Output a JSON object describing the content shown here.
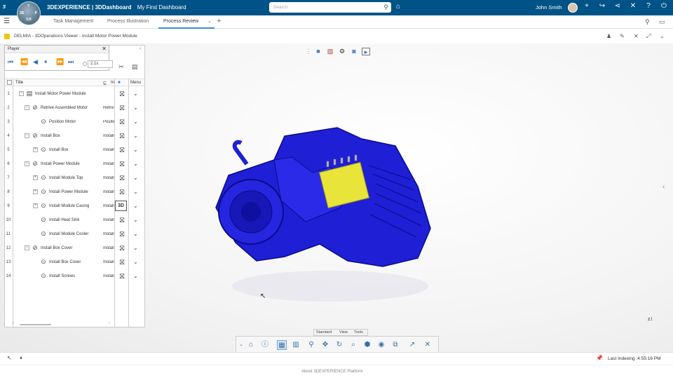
{
  "topbar": {
    "brand_bold": "3DEXPERIENCE | 3DDashboard",
    "dashboard": "My First Dashboard",
    "search_placeholder": "Search",
    "user_name": "John Smith",
    "compass": {
      "top": "?",
      "left": "3D",
      "right": "P",
      "bottom": "V,R"
    }
  },
  "tabs": [
    {
      "label": "Task Management"
    },
    {
      "label": "Process Illustration"
    },
    {
      "label": "Process Review"
    }
  ],
  "app": {
    "title": "DELMIA - 3DOperations Viewer - Install Motor Power Module"
  },
  "player": {
    "title": "Player",
    "time": "2.1s"
  },
  "grid": {
    "col_title": "Title",
    "col_instr": "In",
    "col_menu": "Menu",
    "rows": [
      {
        "num": "1",
        "title": "Install Motor Power Module",
        "instr": "",
        "status": "no-3d",
        "level": 0
      },
      {
        "num": "2",
        "title": "Retrive Assembled Motor",
        "instr": "Retriv",
        "status": "no-3d",
        "level": 1
      },
      {
        "num": "3",
        "title": "Position Motor",
        "instr": "Positio",
        "status": "no-3d",
        "level": 2
      },
      {
        "num": "4",
        "title": "Install Box",
        "instr": "Install",
        "status": "no-3d",
        "level": 1
      },
      {
        "num": "5",
        "title": "Install Box",
        "instr": "Install",
        "status": "no-3d",
        "level": 2
      },
      {
        "num": "6",
        "title": "Install Power Module",
        "instr": "Install",
        "status": "no-3d",
        "level": 1
      },
      {
        "num": "7",
        "title": "Install Module Top",
        "instr": "Install",
        "status": "no-3d",
        "level": 2
      },
      {
        "num": "8",
        "title": "Install Power Module",
        "instr": "Install",
        "status": "no-3d",
        "level": 2
      },
      {
        "num": "9",
        "title": "Install Module Casing",
        "instr": "Install",
        "status": "3D",
        "level": 2
      },
      {
        "num": "10",
        "title": "Install Heat Sink",
        "instr": "Install",
        "status": "no-3d",
        "level": 2
      },
      {
        "num": "11",
        "title": "Install Module Cooler",
        "instr": "Install",
        "status": "no-3d",
        "level": 2
      },
      {
        "num": "12",
        "title": "Install Box Cover",
        "instr": "Install",
        "status": "no-3d",
        "level": 1
      },
      {
        "num": "13",
        "title": "Install Box Cover",
        "instr": "Install",
        "status": "no-3d",
        "level": 2
      },
      {
        "num": "14",
        "title": "Install Screws",
        "instr": "Install",
        "status": "no-3d",
        "level": 2
      }
    ]
  },
  "bottom_tabs": {
    "standard": "Standard",
    "view": "View",
    "tools": "Tools"
  },
  "status": {
    "indexing": "Last Indexing :4:55:16 PM"
  },
  "footer": {
    "about": "About 3DEXPERIENCE Platform"
  },
  "colors": {
    "topbar": "#005386",
    "motor": "#1f1fd6",
    "module": "#e8e43a",
    "accent": "#3b8dd0"
  }
}
